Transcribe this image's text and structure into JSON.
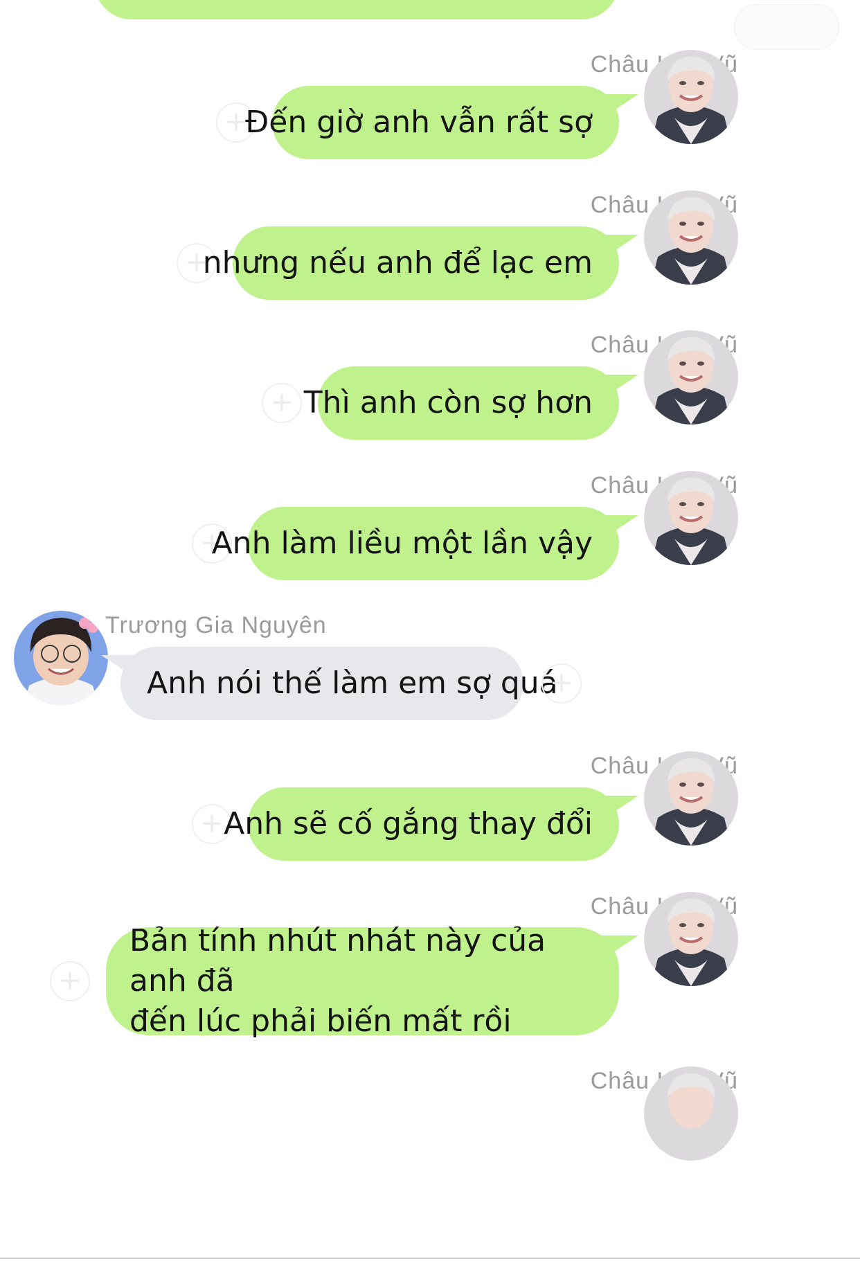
{
  "colors": {
    "outgoing_bubble": "#bff28d",
    "incoming_bubble": "#e7e8ec",
    "sender_name": "#9a9a9a"
  },
  "users": {
    "me": {
      "name": "Châu Kha Vũ"
    },
    "other": {
      "name": "Trương Gia Nguyên"
    }
  },
  "messages": [
    {
      "sender": "Châu Kha Vũ",
      "text": "Đến giờ anh vẫn rất sợ",
      "direction": "outgoing"
    },
    {
      "sender": "Châu Kha Vũ",
      "text": "nhưng nếu anh để lạc em",
      "direction": "outgoing"
    },
    {
      "sender": "Châu Kha Vũ",
      "text": "Thì anh còn sợ hơn",
      "direction": "outgoing"
    },
    {
      "sender": "Châu Kha Vũ",
      "text": "Anh làm liều một lần vậy",
      "direction": "outgoing"
    },
    {
      "sender": "Trương Gia Nguyên",
      "text": "Anh nói thế làm em sợ quá",
      "direction": "incoming"
    },
    {
      "sender": "Châu Kha Vũ",
      "text": "Anh sẽ cố gắng thay đổi",
      "direction": "outgoing"
    },
    {
      "sender": "Châu Kha Vũ",
      "text_lines": [
        "Bản tính nhút nhát này của anh đã",
        "đến lúc phải biến mất rồi"
      ],
      "direction": "outgoing"
    },
    {
      "sender": "Châu Kha Vũ",
      "text": "",
      "direction": "outgoing"
    }
  ],
  "icons": {
    "reaction": "add-reaction-icon",
    "avatar_me": "avatar-chau-kha-vu",
    "avatar_other": "avatar-truong-gia-nguyen"
  }
}
